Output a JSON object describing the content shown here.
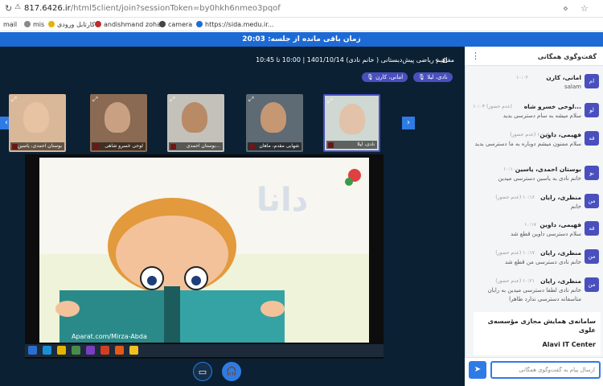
{
  "browser": {
    "url_domain": "817.6426.ir",
    "url_path": "/html5client/join?sessionToken=by0hkh6nmeo3pqof",
    "bookmarks": [
      "mail",
      "mis",
      "کارتابل ورودی",
      "andishmand zoha",
      "camera",
      "https://sida.medu.ir..."
    ]
  },
  "timer_text": "زمان باقی مانده از جلسه: 20:03",
  "session_title": "مفاهیم ریاضی پیش‌دبستانی ( خانم نادی) 1401/10/14 | 10:00 تا 10:45",
  "pills": [
    "نادی، لیلا",
    "امانی، کارن"
  ],
  "tiles": [
    {
      "name": "بوستان احمدی، یاسین",
      "bg": "#d9b89a",
      "face": "#e7c3a3"
    },
    {
      "name": "لوحی خسرو شاهی",
      "bg": "#8a6a52",
      "face": "#caa083"
    },
    {
      "name": "بوستان احمدی...",
      "bg": "#c4c1bb",
      "face": "#b88a66"
    },
    {
      "name": "شهابی مقدم، ماهان",
      "bg": "#5e6a74",
      "face": "#c59772"
    },
    {
      "name": "نادی، لیلا",
      "bg": "#cfd8d2",
      "face": "#e2c2a8"
    }
  ],
  "slide_watermark": "دانا",
  "slide_credit": "Aparat.com/Mirza-Abda",
  "chat": {
    "title": "گفت‌وگوی همگانی",
    "messages": [
      {
        "avatar": "ام",
        "name": "امانی، کارن",
        "time": "۱۰:۰۲",
        "text": "salam"
      },
      {
        "avatar": "لو",
        "name": "لوحی خسرو شاه...",
        "time": "۱۰:۰۴ (عدم حضور)",
        "text": "سلام میشه به سام دسترسی بدید"
      },
      {
        "avatar": "فه",
        "name": "فهیمی، داوین",
        "time": "(عدم حضور) ۱۰:۰۷",
        "text": "سلام ممنون میشم دوباره به ما دسترسی بدید"
      },
      {
        "avatar": "بو",
        "name": "بوستان احمدی، یاسین",
        "time": "۱۰:۱۰",
        "text": "خانم نادی به یاسین دسترسی میدین"
      },
      {
        "avatar": "من",
        "name": "منظری، رایان",
        "time": "(عدم حضور) ۱۰:۱۶",
        "text": "خانم"
      },
      {
        "avatar": "فه",
        "name": "فهیمی، داوین",
        "time": "۱۰:۱۷",
        "text": "سلام دسترسی داوین قطع شد"
      },
      {
        "avatar": "من",
        "name": "منظری، رایان",
        "time": "(عدم حضور) ۱۰:۱۷",
        "text": "خانم نادی دسترسی من قطع شد"
      },
      {
        "avatar": "من",
        "name": "منظری، رایان",
        "time": "(عدم حضور) ۱۰:۲۱",
        "text": "خانم نادی لطفا دسترسی میدین به رایان متاسفانه دسترسی ندارد طاهرا"
      }
    ],
    "info_title": "سامانه‌ی همایش مجازی مؤسسه‌ی علوی",
    "info_sub": "Alavi IT Center",
    "input_placeholder": "ارسال پیام به گفت‌وگوی همگانی"
  },
  "colors": {
    "accent": "#2f7be6",
    "dark": "#0b2033",
    "timer": "#1e6ad5",
    "pill": "#4a4fbe"
  }
}
